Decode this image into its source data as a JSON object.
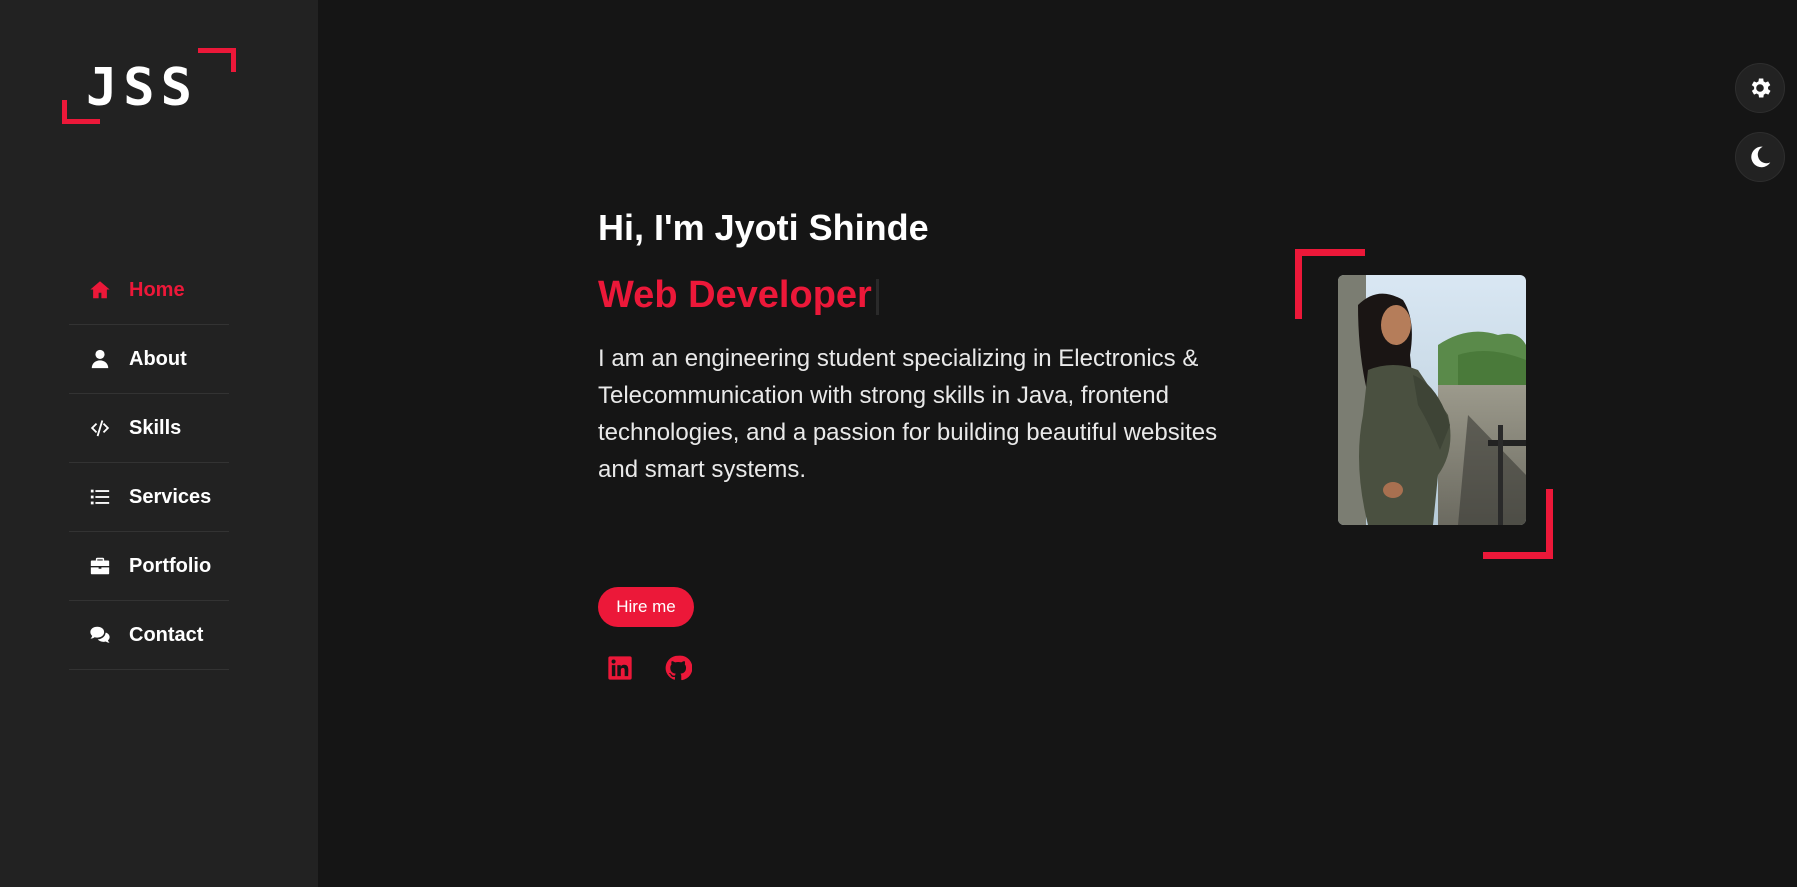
{
  "logo": {
    "text": "JSS"
  },
  "nav": {
    "items": [
      {
        "label": "Home",
        "icon": "home-icon",
        "active": true
      },
      {
        "label": "About",
        "icon": "user-icon",
        "active": false
      },
      {
        "label": "Skills",
        "icon": "code-icon",
        "active": false
      },
      {
        "label": "Services",
        "icon": "list-icon",
        "active": false
      },
      {
        "label": "Portfolio",
        "icon": "briefcase-icon",
        "active": false
      },
      {
        "label": "Contact",
        "icon": "comments-icon",
        "active": false
      }
    ]
  },
  "controls": {
    "settings_icon": "gear-icon",
    "theme_icon": "moon-icon"
  },
  "hero": {
    "greeting": "Hi, I'm Jyoti Shinde",
    "role": "Web Developer",
    "bio": "I am an engineering student specializing in Electronics & Telecommunication with strong skills in Java, frontend technologies, and a passion for building beautiful websites and smart systems.",
    "hire_label": "Hire me",
    "social": [
      {
        "icon": "linkedin-icon"
      },
      {
        "icon": "github-icon"
      }
    ]
  },
  "colors": {
    "accent": "#ec1839",
    "sidebar_bg": "#222222",
    "page_bg": "#151515",
    "text": "#ffffff"
  }
}
